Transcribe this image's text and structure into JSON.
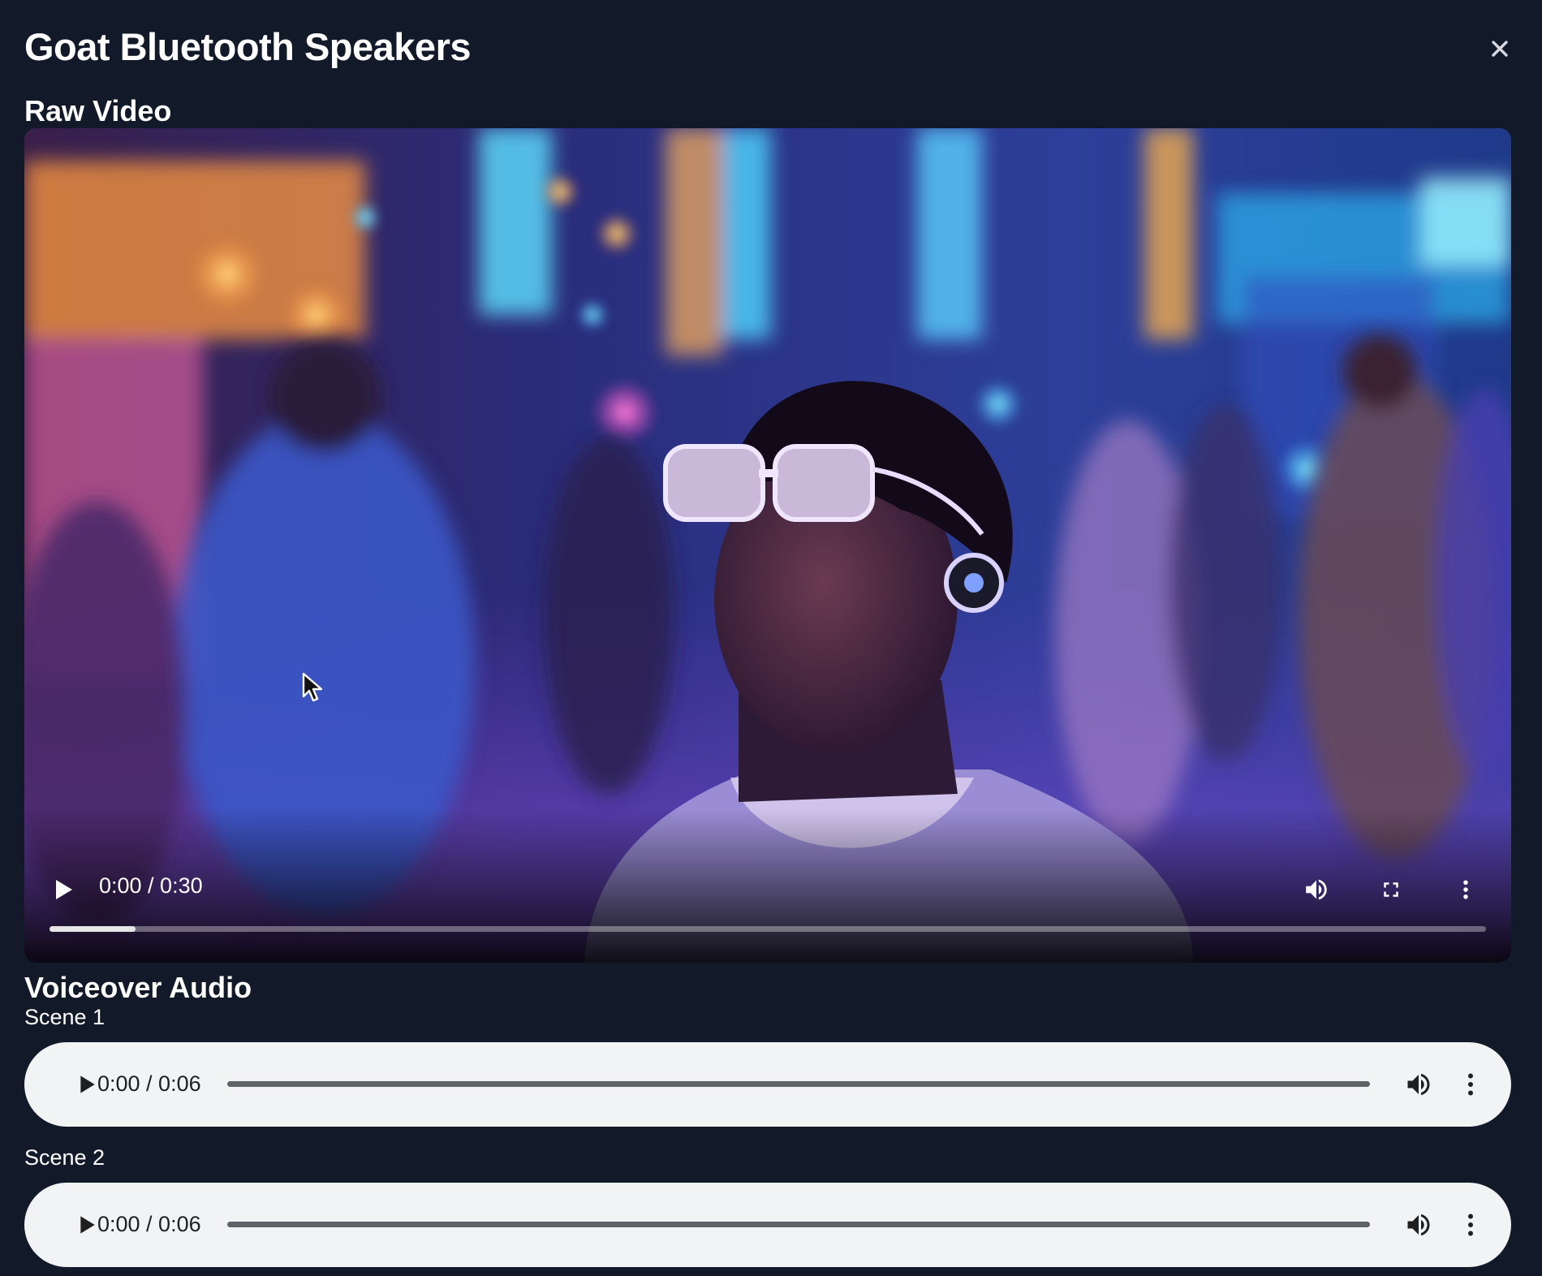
{
  "modal": {
    "title": "Goat Bluetooth Speakers",
    "close_icon": "close-icon"
  },
  "raw_video": {
    "heading": "Raw Video",
    "time_display": "0:00 / 0:30",
    "progress_fraction": 0.06,
    "icons": {
      "play": "play-icon",
      "volume": "volume-icon",
      "fullscreen": "fullscreen-icon",
      "more": "more-vert-icon"
    }
  },
  "voiceover": {
    "heading": "Voiceover Audio",
    "scenes": [
      {
        "label": "Scene 1",
        "time_display": "0:00 / 0:06"
      },
      {
        "label": "Scene 2",
        "time_display": "0:00 / 0:06"
      }
    ]
  },
  "colors": {
    "background": "#121a2a",
    "audio_bar": "#f1f3f4",
    "text": "#ffffff"
  }
}
